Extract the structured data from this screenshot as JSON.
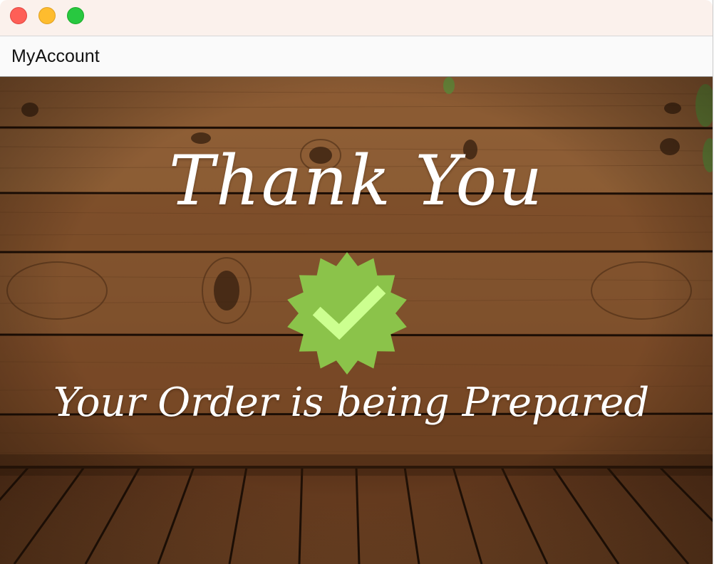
{
  "window": {
    "traffic_lights": {
      "close_color": "#fe5f57",
      "minimize_color": "#febc2e",
      "zoom_color": "#28c840"
    }
  },
  "menubar": {
    "title": "MyAccount"
  },
  "confirmation": {
    "heading": "Thank You",
    "message": "Your Order is being Prepared",
    "badge_icon": "verified-check-badge-icon",
    "badge_color": "#8bc34a",
    "check_color": "#ccff90"
  },
  "background": {
    "description_icon": "wood-plank-wall-and-floor",
    "wood_color": "#7a4a25"
  }
}
